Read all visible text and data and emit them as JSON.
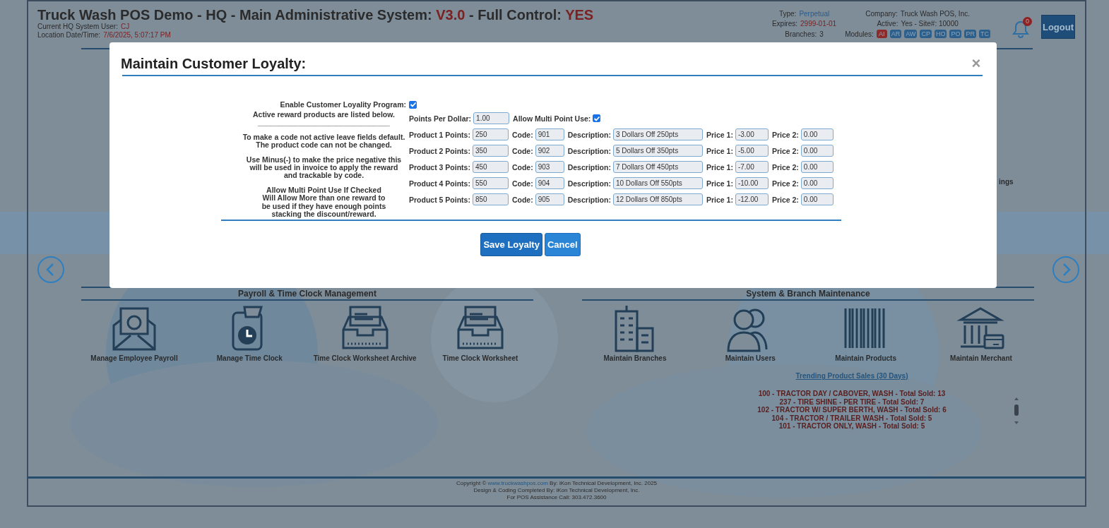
{
  "header": {
    "title_parts": [
      {
        "text": "Truck Wash POS Demo - HQ - Main Administrative System: ",
        "highlight": false
      },
      {
        "text": "V3.0",
        "highlight": true
      },
      {
        "text": " - Full Control: ",
        "highlight": false
      },
      {
        "text": "YES",
        "highlight": true
      }
    ],
    "user_label": "Current HQ System User:",
    "user": "CJ",
    "datetime_label": "Location Date/Time:",
    "datetime": "7/6/2025, 5:07:17 PM",
    "info": [
      {
        "label": "Type:",
        "value": "Perpetual",
        "color": "#2a5c8a"
      },
      {
        "label": "Company:",
        "value": "Truck Wash POS, Inc.",
        "color": "#2b2b2b"
      },
      {
        "label": "Expires:",
        "value": "2999-01-01",
        "color": "#7a2222"
      },
      {
        "label": "Active:",
        "value": "Yes - Site#: 10000",
        "color": "#2b2b2b"
      },
      {
        "label": "Branches:",
        "value": "3",
        "color": "#2b2b2b"
      }
    ],
    "modules_label": "Modules:",
    "modules": [
      {
        "code": "AI",
        "color": "#8e2a2a"
      },
      {
        "code": "AR",
        "color": "#2c5f8c"
      },
      {
        "code": "AW",
        "color": "#2c5f8c"
      },
      {
        "code": "CP",
        "color": "#2c5f8c"
      },
      {
        "code": "HO",
        "color": "#2c5f8c"
      },
      {
        "code": "PO",
        "color": "#2c5f8c"
      },
      {
        "code": "PR",
        "color": "#2c5f8c"
      },
      {
        "code": "TC",
        "color": "#2c5f8c"
      }
    ],
    "notifications": "0",
    "logout": "Logout"
  },
  "partial_label": "ings",
  "sections": [
    {
      "title": "Payroll & Time Clock Management",
      "tiles": [
        {
          "label": "Manage Employee Payroll",
          "kind": "payroll"
        },
        {
          "label": "Manage Time Clock",
          "kind": "clock"
        },
        {
          "label": "Time Clock Worksheet Archive",
          "kind": "tray"
        },
        {
          "label": "Time Clock Worksheet",
          "kind": "tray"
        }
      ]
    },
    {
      "title": "System & Branch Maintenance",
      "tiles": [
        {
          "label": "Maintain Branches",
          "kind": "building"
        },
        {
          "label": "Maintain Users",
          "kind": "users"
        },
        {
          "label": "Maintain Products",
          "kind": "barcode"
        },
        {
          "label": "Maintain Merchant",
          "kind": "bank"
        }
      ]
    }
  ],
  "trending": {
    "title": "Trending Product Sales (30 Days)",
    "items": [
      "100 - TRACTOR DAY / CABOVER, WASH - Total Sold: 13",
      "237 - TIRE SHINE - PER TIRE - Total Sold: 7",
      "102 - TRACTOR W/ SUPER BERTH, WASH - Total Sold: 6",
      "104 - TRACTOR / TRAILER WASH - Total Sold: 5",
      "101 - TRACTOR ONLY, WASH - Total Sold: 5"
    ]
  },
  "footer": {
    "copyright_before": "Copyright © ",
    "copyright_link": "www.truckwashpos.com",
    "copyright_after": " By: iKon Technical Development, Inc. 2025",
    "lines": [
      "Design & Coding Completed By: iKon Technical Development, Inc.",
      "For POS Assistance Call: 303.472.3600"
    ]
  },
  "modal": {
    "title": "Maintain Customer Loyalty:",
    "close": "×",
    "enable": {
      "label": "Enable Customer Loyality Program:",
      "checked": true
    },
    "notes": [
      [
        "Active reward products are listed below.",
        "________________________________"
      ],
      [
        "To make a code not active leave fields default.",
        "The product code can not be changed."
      ],
      [
        "Use Minus(-) to make the price negative this",
        "will be used in invoice to apply the reward",
        "and trackable by code."
      ],
      [
        "Allow Multi Point Use If Checked",
        "Will Allow More than one reward to",
        "be used if they have enough points",
        "stacking the discount/reward."
      ]
    ],
    "points_per_dollar": {
      "label": "Points Per Dollar:",
      "value": "1.00"
    },
    "multi_point": {
      "label": "Allow Multi Point Use:",
      "checked": true
    },
    "products": [
      {
        "label": "Product 1 Points:",
        "points": "250",
        "code_label": "Code:",
        "code": "901",
        "description_label": "Description:",
        "description": "3 Dollars Off 250pts",
        "price1_label": "Price 1:",
        "price1": "-3.00",
        "price2_label": "Price 2:",
        "price2": "0.00"
      },
      {
        "label": "Product 2 Points:",
        "points": "350",
        "code_label": "Code:",
        "code": "902",
        "description_label": "Description:",
        "description": "5 Dollars Off 350pts",
        "price1_label": "Price 1:",
        "price1": "-5.00",
        "price2_label": "Price 2:",
        "price2": "0.00"
      },
      {
        "label": "Product 3 Points:",
        "points": "450",
        "code_label": "Code:",
        "code": "903",
        "description_label": "Description:",
        "description": "7 Dollars Off 450pts",
        "price1_label": "Price 1:",
        "price1": "-7.00",
        "price2_label": "Price 2:",
        "price2": "0.00"
      },
      {
        "label": "Product 4 Points:",
        "points": "550",
        "code_label": "Code:",
        "code": "904",
        "description_label": "Description:",
        "description": "10 Dollars Off 550pts",
        "price1_label": "Price 1:",
        "price1": "-10.00",
        "price2_label": "Price 2:",
        "price2": "0.00"
      },
      {
        "label": "Product 5 Points:",
        "points": "850",
        "code_label": "Code:",
        "code": "905",
        "description_label": "Description:",
        "description": "12 Dollars Off 850pts",
        "price1_label": "Price 1:",
        "price1": "-12.00",
        "price2_label": "Price 2:",
        "price2": "0.00"
      }
    ],
    "buttons": [
      {
        "label": "Save Loyalty",
        "kind": "primary"
      },
      {
        "label": "Cancel",
        "kind": "secondary"
      }
    ]
  }
}
